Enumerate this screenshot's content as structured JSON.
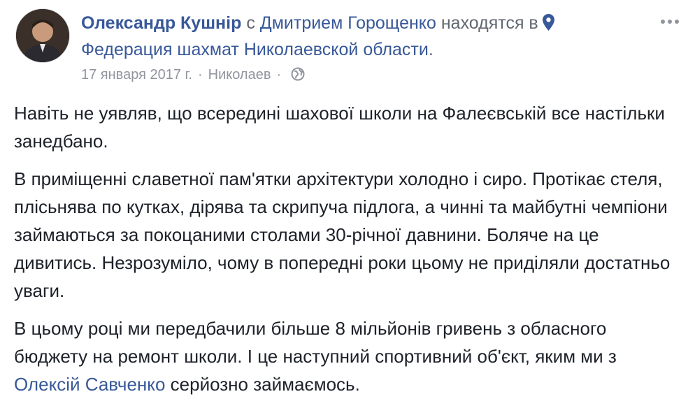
{
  "post": {
    "author": "Олександр Кушнір",
    "with_word": "с",
    "tagged_person": "Дмитрием Горощенко",
    "at_text": "находятся в",
    "place": "Федерация шахмат Николаевской области",
    "place_end": ".",
    "date": "17 января 2017 г.",
    "location": "Николаев",
    "separator": "·",
    "icons": {
      "more": "more-options-icon",
      "location": "map-pin-icon",
      "privacy": "globe-icon"
    },
    "accent_color": "#385898",
    "paragraphs": [
      {
        "text": "Навіть не уявляв, що всередині шахової школи на Фалеєвській все настільки занедбано."
      },
      {
        "text": "В приміщенні славетної пам'ятки архітектури холодно і сиро. Протікає стеля, плісьнява по кутках, дірява та скрипуча підлога, а чинні та майбутні чемпіони займаються за покоцаними столами 30-річної давнини. Боляче на це дивитись. Незрозуміло, чому в попередні роки цьому не приділяли достатньо уваги."
      },
      {
        "before": "В цьому році ми передбачили більше 8 мільйонів гривень з обласного бюджету на ремонт школи. І це наступний спортивний об'єкт, яким ми з ",
        "mention": "Олексій Савченко",
        "after": " серйозно займаємось."
      }
    ]
  }
}
